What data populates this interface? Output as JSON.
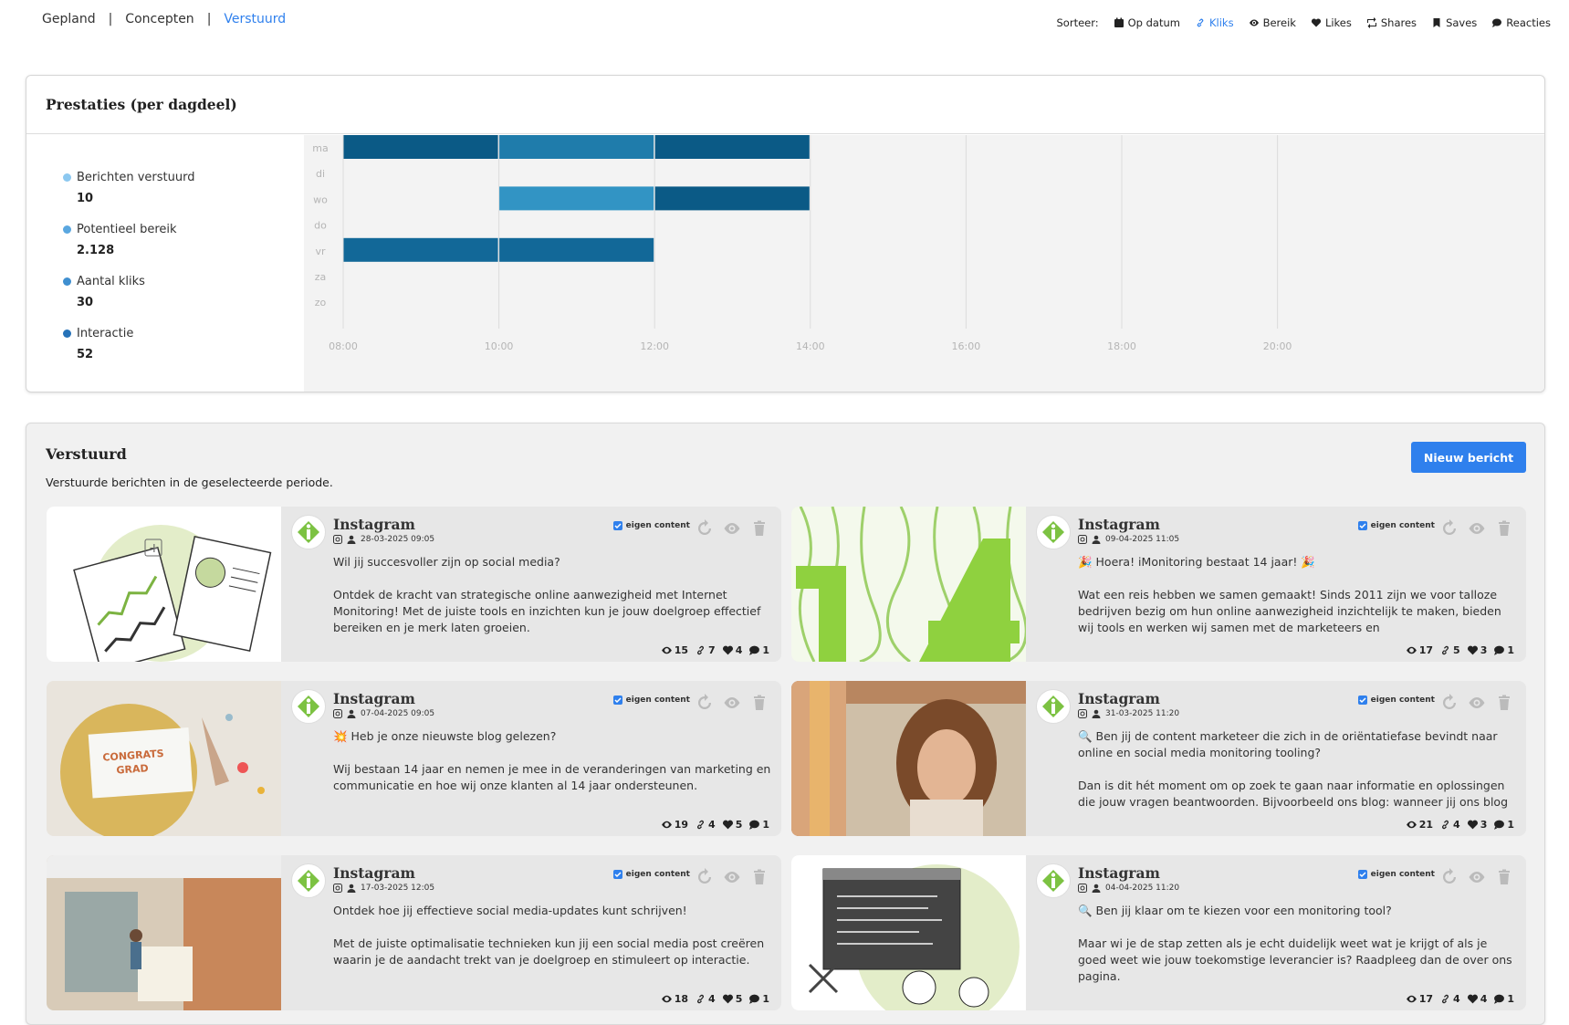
{
  "tabs": {
    "gepland": "Gepland",
    "sep1": "|",
    "concepten": "Concepten",
    "sep2": "|",
    "verstuurd": "Verstuurd"
  },
  "sort": {
    "label": "Sorteer:",
    "op_datum": "Op datum",
    "kliks": "Kliks",
    "bereik": "Bereik",
    "likes": "Likes",
    "shares": "Shares",
    "saves": "Saves",
    "reacties": "Reacties",
    "active": "kliks"
  },
  "performance": {
    "title": "Prestaties (per dagdeel)",
    "legend": [
      {
        "label": "Berichten verstuurd",
        "value": "10",
        "color": "#8cc8f0"
      },
      {
        "label": "Potentieel bereik",
        "value": "2.128",
        "color": "#5aa7e0"
      },
      {
        "label": "Aantal kliks",
        "value": "30",
        "color": "#3f8fd0"
      },
      {
        "label": "Interactie",
        "value": "52",
        "color": "#2672b8"
      }
    ]
  },
  "chart_data": {
    "type": "bar",
    "orientation": "horizontal-timeline",
    "y_categories": [
      "ma",
      "di",
      "wo",
      "do",
      "vr",
      "za",
      "zo"
    ],
    "x_ticks": [
      "08:00",
      "10:00",
      "12:00",
      "14:00",
      "16:00",
      "18:00",
      "20:00"
    ],
    "xlim": [
      "08:00",
      "21:00"
    ],
    "segments": [
      {
        "day": "ma",
        "start": "08:00",
        "end": "10:00",
        "color": "#0b5a86"
      },
      {
        "day": "ma",
        "start": "10:00",
        "end": "12:00",
        "color": "#1f7cab"
      },
      {
        "day": "ma",
        "start": "12:00",
        "end": "14:00",
        "color": "#0b5a86"
      },
      {
        "day": "wo",
        "start": "10:00",
        "end": "12:00",
        "color": "#3294c4"
      },
      {
        "day": "wo",
        "start": "12:00",
        "end": "14:00",
        "color": "#0b5a86"
      },
      {
        "day": "vr",
        "start": "08:00",
        "end": "10:00",
        "color": "#126898"
      },
      {
        "day": "vr",
        "start": "10:00",
        "end": "12:00",
        "color": "#126898"
      }
    ]
  },
  "sent": {
    "title": "Verstuurd",
    "subtitle": "Verstuurde berichten in de geselecteerde periode.",
    "new_button": "Nieuw bericht"
  },
  "posts": [
    {
      "platform": "Instagram",
      "date": "28-03-2025 09:05",
      "badge": "eigen content",
      "text": "Wil jij succesvoller zijn op social media?\n\nOntdek de kracht van strategische online aanwezigheid met Internet Monitoring! Met de juiste tools en inzichten kun je jouw doelgroep effectief bereiken en je merk laten groeien.",
      "views": "15",
      "clicks": "7",
      "likes": "4",
      "comments": "1"
    },
    {
      "platform": "Instagram",
      "date": "09-04-2025 11:05",
      "badge": "eigen content",
      "text": "🎉 Hoera! iMonitoring bestaat 14 jaar! 🎉\n\nWat een reis hebben we samen gemaakt! Sinds 2011 zijn we voor talloze bedrijven bezig om hun online aanwezigheid inzichtelijk te maken, bieden wij tools en werken wij samen met de marketeers en",
      "views": "17",
      "clicks": "5",
      "likes": "3",
      "comments": "1"
    },
    {
      "platform": "Instagram",
      "date": "07-04-2025 09:05",
      "badge": "eigen content",
      "text": "💥 Heb je onze nieuwste blog gelezen?\n\nWij bestaan 14 jaar en nemen je mee in de veranderingen van marketing en communicatie en hoe wij onze klanten al 14 jaar ondersteunen.",
      "views": "19",
      "clicks": "4",
      "likes": "5",
      "comments": "1"
    },
    {
      "platform": "Instagram",
      "date": "31-03-2025 11:20",
      "badge": "eigen content",
      "text": "🔍 Ben jij de content marketeer die zich in de oriëntatiefase bevindt naar online en social media monitoring tooling?\n\nDan is dit hét moment om op zoek te gaan naar informatie en oplossingen die jouw vragen beantwoorden. Bijvoorbeeld ons blog: wanneer jij ons blog",
      "views": "21",
      "clicks": "4",
      "likes": "3",
      "comments": "1"
    },
    {
      "platform": "Instagram",
      "date": "17-03-2025 12:05",
      "badge": "eigen content",
      "text": "Ontdek hoe jij effectieve social media-updates kunt schrijven!\n\nMet de juiste optimalisatie technieken kun jij een social media post creëren waarin je de aandacht trekt van je doelgroep en stimuleert op interactie.",
      "views": "18",
      "clicks": "4",
      "likes": "5",
      "comments": "1"
    },
    {
      "platform": "Instagram",
      "date": "04-04-2025 11:20",
      "badge": "eigen content",
      "text": "🔍 Ben jij klaar om te kiezen voor een monitoring tool?\n\nMaar wi je de stap zetten als je echt duidelijk weet wat je krijgt of als je goed weet wie jouw toekomstige leverancier is? Raadpleeg dan de over ons pagina.",
      "views": "17",
      "clicks": "4",
      "likes": "4",
      "comments": "1"
    }
  ]
}
